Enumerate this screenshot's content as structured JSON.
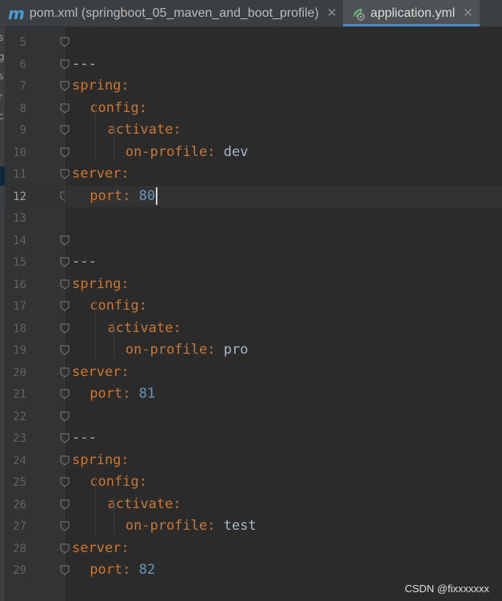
{
  "tabs": [
    {
      "label": "pom.xml (springboot_05_maven_and_boot_profile)",
      "icon": "maven-icon",
      "active": false
    },
    {
      "label": "application.yml",
      "icon": "spring-config-icon",
      "active": true
    }
  ],
  "close_glyph": "✕",
  "maven_glyph": "m",
  "project_strip_chars": [
    "s",
    "g",
    "s",
    "r",
    "c"
  ],
  "current_line": 12,
  "lines": [
    {
      "n": "5",
      "indent": 0,
      "type": "blank"
    },
    {
      "n": "6",
      "indent": 0,
      "type": "doc",
      "text": "---"
    },
    {
      "n": "7",
      "indent": 0,
      "type": "key",
      "key": "spring",
      "value": ""
    },
    {
      "n": "8",
      "indent": 1,
      "type": "key",
      "key": "config",
      "value": ""
    },
    {
      "n": "9",
      "indent": 2,
      "type": "key",
      "key": "activate",
      "value": ""
    },
    {
      "n": "10",
      "indent": 3,
      "type": "key",
      "key": "on-profile",
      "value": "dev"
    },
    {
      "n": "11",
      "indent": 0,
      "type": "key",
      "key": "server",
      "value": ""
    },
    {
      "n": "12",
      "indent": 1,
      "type": "key",
      "key": "port",
      "value": "80",
      "numeric": true
    },
    {
      "n": "13",
      "indent": 0,
      "type": "blank"
    },
    {
      "n": "14",
      "indent": 0,
      "type": "blank"
    },
    {
      "n": "15",
      "indent": 0,
      "type": "doc",
      "text": "---"
    },
    {
      "n": "16",
      "indent": 0,
      "type": "key",
      "key": "spring",
      "value": ""
    },
    {
      "n": "17",
      "indent": 1,
      "type": "key",
      "key": "config",
      "value": ""
    },
    {
      "n": "18",
      "indent": 2,
      "type": "key",
      "key": "activate",
      "value": ""
    },
    {
      "n": "19",
      "indent": 3,
      "type": "key",
      "key": "on-profile",
      "value": "pro"
    },
    {
      "n": "20",
      "indent": 0,
      "type": "key",
      "key": "server",
      "value": ""
    },
    {
      "n": "21",
      "indent": 1,
      "type": "key",
      "key": "port",
      "value": "81",
      "numeric": true
    },
    {
      "n": "22",
      "indent": 0,
      "type": "blank"
    },
    {
      "n": "23",
      "indent": 0,
      "type": "doc",
      "text": "---"
    },
    {
      "n": "24",
      "indent": 0,
      "type": "key",
      "key": "spring",
      "value": ""
    },
    {
      "n": "25",
      "indent": 1,
      "type": "key",
      "key": "config",
      "value": ""
    },
    {
      "n": "26",
      "indent": 2,
      "type": "key",
      "key": "activate",
      "value": ""
    },
    {
      "n": "27",
      "indent": 3,
      "type": "key",
      "key": "on-profile",
      "value": "test"
    },
    {
      "n": "28",
      "indent": 0,
      "type": "key",
      "key": "server",
      "value": ""
    },
    {
      "n": "29",
      "indent": 1,
      "type": "key",
      "key": "port",
      "value": "82",
      "numeric": true
    }
  ],
  "watermark": "CSDN @fixxxxxxx",
  "colors": {
    "background": "#2b2b2b",
    "key": "#cc7832",
    "number": "#6897bb",
    "text": "#a9b7c6",
    "line_number": "#606366",
    "tab_underline": "#4a88c7"
  }
}
